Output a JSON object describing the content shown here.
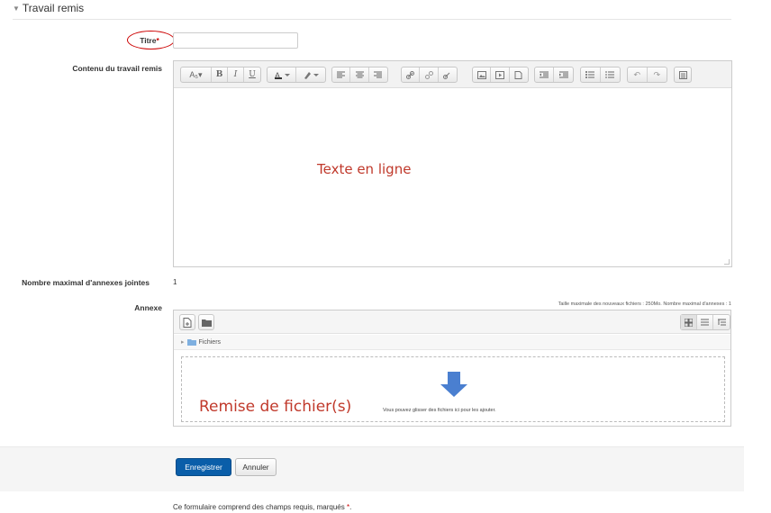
{
  "section": {
    "title": "Travail remis"
  },
  "fields": {
    "titre_label": "Titre",
    "required_mark": "*",
    "titre_value": "",
    "contenu_label": "Contenu du travail remis",
    "max_annexes_label": "Nombre maximal d'annexes jointes",
    "max_annexes_value": "1",
    "annexe_label": "Annexe"
  },
  "editor": {
    "annotation": "Texte en ligne",
    "toolbar_icons": [
      "style-icon",
      "bold-icon",
      "italic-icon",
      "underline-icon",
      "text-color-icon",
      "highlight-icon",
      "align-left-icon",
      "align-center-icon",
      "align-right-icon",
      "link-icon",
      "unlink-icon",
      "anchor-icon",
      "image-icon",
      "media-icon",
      "file-icon",
      "outdent-icon",
      "indent-icon",
      "bullet-list-icon",
      "numbered-list-icon",
      "undo-icon",
      "redo-icon",
      "html-icon"
    ],
    "toolbar_glyphs": {
      "style": "A₅▾",
      "bold": "B",
      "italic": "I",
      "underline": "U"
    }
  },
  "filemanager": {
    "limits_text": "Taille maximale des nouveaux fichiers : 250Mo. Nombre maximal d'annexes : 1",
    "path_label": "Fichiers",
    "drop_text": "Vous pouvez glisser des fichiers ici pour les ajouter.",
    "annotation": "Remise de fichier(s)"
  },
  "buttons": {
    "save": "Enregistrer",
    "cancel": "Annuler"
  },
  "footer": {
    "note": "Ce formulaire comprend des champs requis, marqués",
    "note_mark": "*",
    "note_end": "."
  },
  "colors": {
    "accent": "#0a5ea9",
    "required": "#cc0000",
    "annotation": "#c0392b",
    "drop_arrow": "#4a7fd0"
  }
}
